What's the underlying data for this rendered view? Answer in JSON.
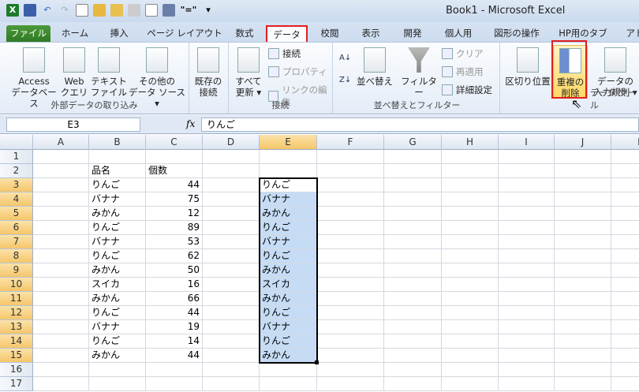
{
  "window": {
    "title": "Book1  -  Microsoft Excel"
  },
  "qat": [
    "excel-logo-icon",
    "save-icon",
    "undo-icon",
    "redo-icon",
    "new-icon",
    "open-icon",
    "folder-icon",
    "calculator-icon",
    "print-preview-icon",
    "save-as-icon",
    "equals-icon",
    "customize-icon"
  ],
  "qat_equals": "\"=\"",
  "tabs": [
    "ファイル",
    "ホーム",
    "挿入",
    "ページ レイアウト",
    "数式",
    "データ",
    "校閲",
    "表示",
    "開発",
    "個人用",
    "図形の操作",
    "HP用のタブ",
    "アド"
  ],
  "ribbon": {
    "groups": {
      "external": "外部データの取り込み",
      "connections": "接続",
      "sortfilter": "並べ替えとフィルター",
      "tools": "データ ツール"
    },
    "access": [
      "Access",
      "データベース"
    ],
    "web": [
      "Web",
      "クエリ"
    ],
    "text": [
      "テキスト",
      "ファイル"
    ],
    "other": [
      "その他の",
      "データ ソース ▾"
    ],
    "existing": [
      "既存の",
      "接続"
    ],
    "refresh": [
      "すべて",
      "更新 ▾"
    ],
    "conn": "接続",
    "props": "プロパティ",
    "links": "リンクの編集",
    "sort": "並べ替え",
    "filter": "フィルター",
    "clear": "クリア",
    "reapply": "再適用",
    "advanced": "詳細設定",
    "split": "区切り位置",
    "dup": [
      "重複の",
      "削除"
    ],
    "valid": [
      "データの",
      "入力規則 ▾"
    ]
  },
  "namebox": "E3",
  "fx": "fx",
  "formula": "りんご",
  "columns": [
    "A",
    "B",
    "C",
    "D",
    "E",
    "F",
    "G",
    "H",
    "I",
    "J",
    "K"
  ],
  "rows": [
    "1",
    "2",
    "3",
    "4",
    "5",
    "6",
    "7",
    "8",
    "9",
    "10",
    "11",
    "12",
    "13",
    "14",
    "15",
    "16",
    "17"
  ],
  "table": {
    "headers": [
      "品名",
      "個数"
    ],
    "items": [
      [
        "りんご",
        "44"
      ],
      [
        "バナナ",
        "75"
      ],
      [
        "みかん",
        "12"
      ],
      [
        "りんご",
        "89"
      ],
      [
        "バナナ",
        "53"
      ],
      [
        "りんご",
        "62"
      ],
      [
        "みかん",
        "50"
      ],
      [
        "スイカ",
        "16"
      ],
      [
        "みかん",
        "66"
      ],
      [
        "りんご",
        "44"
      ],
      [
        "バナナ",
        "19"
      ],
      [
        "りんご",
        "14"
      ],
      [
        "みかん",
        "44"
      ]
    ]
  },
  "colE": [
    "りんご",
    "バナナ",
    "みかん",
    "りんご",
    "バナナ",
    "りんご",
    "みかん",
    "スイカ",
    "みかん",
    "りんご",
    "バナナ",
    "りんご",
    "みかん"
  ],
  "colors": {
    "selection": "#c6dcf5",
    "highlight": "#e02020",
    "file_tab": "#2f7a23"
  }
}
